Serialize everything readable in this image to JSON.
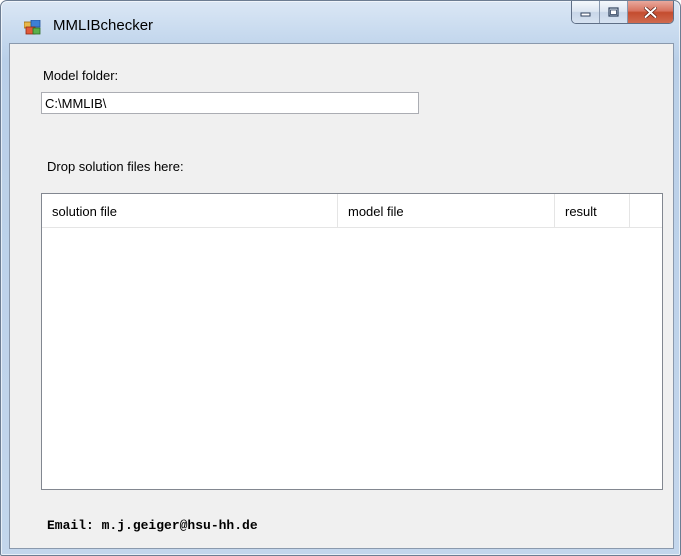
{
  "window": {
    "title": "MMLIBchecker"
  },
  "form": {
    "model_folder_label": "Model folder:",
    "model_folder_value": "C:\\MMLIB\\",
    "drop_label": "Drop solution files here:"
  },
  "list": {
    "columns": [
      "solution file",
      "model file",
      "result",
      ""
    ],
    "rows": []
  },
  "footer": {
    "email": "Email: m.j.geiger@hsu-hh.de"
  }
}
